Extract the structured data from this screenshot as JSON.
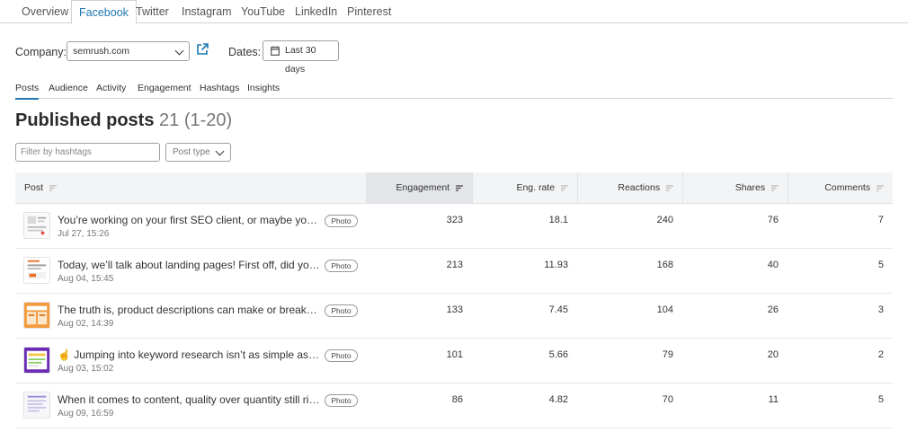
{
  "platform_tabs": [
    "Overview",
    "Facebook",
    "Twitter",
    "Instagram",
    "YouTube",
    "LinkedIn",
    "Pinterest"
  ],
  "filters": {
    "company_label": "Company:",
    "company_value": "semrush.com",
    "dates_label": "Dates:",
    "dates_value": "Last 30 days",
    "hashtag_placeholder": "Filter by hashtags",
    "post_type_label": "Post type"
  },
  "sub_tabs": [
    "Posts",
    "Audience",
    "Activity",
    "Engagement",
    "Hashtags",
    "Insights"
  ],
  "title": {
    "main": "Published posts",
    "count": "21 (1-20)"
  },
  "table": {
    "columns": [
      "Post",
      "Engagement",
      "Eng. rate",
      "Reactions",
      "Shares",
      "Comments"
    ],
    "rows": [
      {
        "text": "You’re working on your first SEO client, or maybe your …",
        "date": "Jul 27, 15:26",
        "type": "Photo",
        "engagement": "323",
        "eng_rate": "18.1",
        "reactions": "240",
        "shares": "76",
        "comments": "7"
      },
      {
        "text": "Today, we’ll talk about landing pages! First off, did you …",
        "date": "Aug 04, 15:45",
        "type": "Photo",
        "engagement": "213",
        "eng_rate": "11.93",
        "reactions": "168",
        "shares": "40",
        "comments": "5"
      },
      {
        "text": "The truth is, product descriptions can make or break y…",
        "date": "Aug 02, 14:39",
        "type": "Photo",
        "engagement": "133",
        "eng_rate": "7.45",
        "reactions": "104",
        "shares": "26",
        "comments": "3"
      },
      {
        "text": "☝️ Jumping into keyword research isn’t as simple as it s…",
        "date": "Aug 03, 15:02",
        "type": "Photo",
        "engagement": "101",
        "eng_rate": "5.66",
        "reactions": "79",
        "shares": "20",
        "comments": "2"
      },
      {
        "text": "When it comes to content, quality over quantity still ri…",
        "date": "Aug 09, 16:59",
        "type": "Photo",
        "engagement": "86",
        "eng_rate": "4.82",
        "reactions": "70",
        "shares": "11",
        "comments": "5"
      }
    ]
  },
  "colors": {
    "accent": "#1f78b4",
    "header_bg": "#f3f4f5",
    "sorted_bg": "#e3e5e8"
  }
}
